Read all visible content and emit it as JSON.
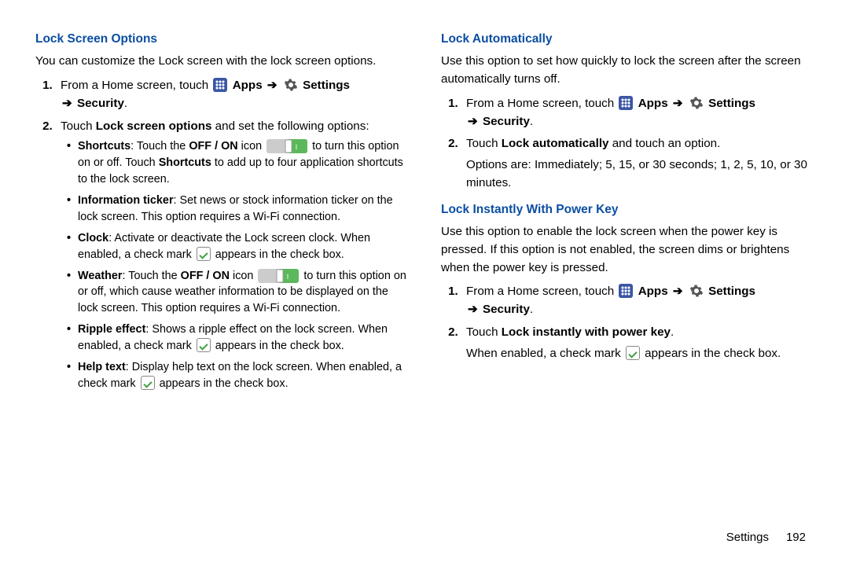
{
  "left": {
    "h1": "Lock Screen Options",
    "intro": "You can customize the Lock screen with the lock screen options.",
    "step1_a": "From a Home screen, touch ",
    "step1_apps": " Apps ",
    "step1_settings": " Settings ",
    "step1_security": " Security",
    "step2_a": "Touch ",
    "step2_b": "Lock screen options",
    "step2_c": " and set the following options:",
    "bullets": {
      "b1a": "Shortcuts",
      "b1b": ": Touch the ",
      "b1c": "OFF / ON",
      "b1d": " icon ",
      "b1e": " to turn this option on or off. Touch ",
      "b1f": "Shortcuts",
      "b1g": " to add up to four application shortcuts to the lock screen.",
      "b2a": "Information ticker",
      "b2b": ": Set news or stock information ticker on the lock screen. This option requires a Wi-Fi connection.",
      "b3a": "Clock",
      "b3b": ": Activate or deactivate the Lock screen clock. When enabled, a check mark ",
      "b3c": " appears in the check box.",
      "b4a": "Weather",
      "b4b": ": Touch the ",
      "b4c": "OFF / ON",
      "b4d": " icon ",
      "b4e": " to turn this option on or off, which cause weather information to be displayed on the lock screen. This option requires a Wi-Fi connection.",
      "b5a": "Ripple effect",
      "b5b": ": Shows a ripple effect on the lock screen. When enabled, a check mark ",
      "b5c": " appears in the check box.",
      "b6a": "Help text",
      "b6b": ": Display help text on the lock screen. When enabled, a check mark ",
      "b6c": " appears in the check box."
    }
  },
  "right": {
    "h1": "Lock Automatically",
    "intro": "Use this option to set how quickly to lock the screen after the screen automatically turns off.",
    "step1_a": "From a Home screen, touch ",
    "step1_apps": " Apps ",
    "step1_settings": " Settings ",
    "step1_security": " Security",
    "step2_a": "Touch ",
    "step2_b": "Lock automatically",
    "step2_c": " and touch an option.",
    "step2_d": "Options are: Immediately; 5, 15, or 30 seconds; 1, 2, 5, 10, or 30 minutes.",
    "h2": "Lock Instantly With Power Key",
    "intro2": "Use this option to enable the lock screen when the power key is pressed. If this option is not enabled, the screen dims or brightens when the power key is pressed.",
    "s2_step1_a": "From a Home screen, touch ",
    "s2_step2_a": "Touch ",
    "s2_step2_b": "Lock instantly with power key",
    "s2_step2_c": ".",
    "s2_step2_d1": "When enabled, a check mark ",
    "s2_step2_d2": " appears in the check box."
  },
  "footer": {
    "label": "Settings",
    "page": "192"
  },
  "arrow_glyph": "➔"
}
